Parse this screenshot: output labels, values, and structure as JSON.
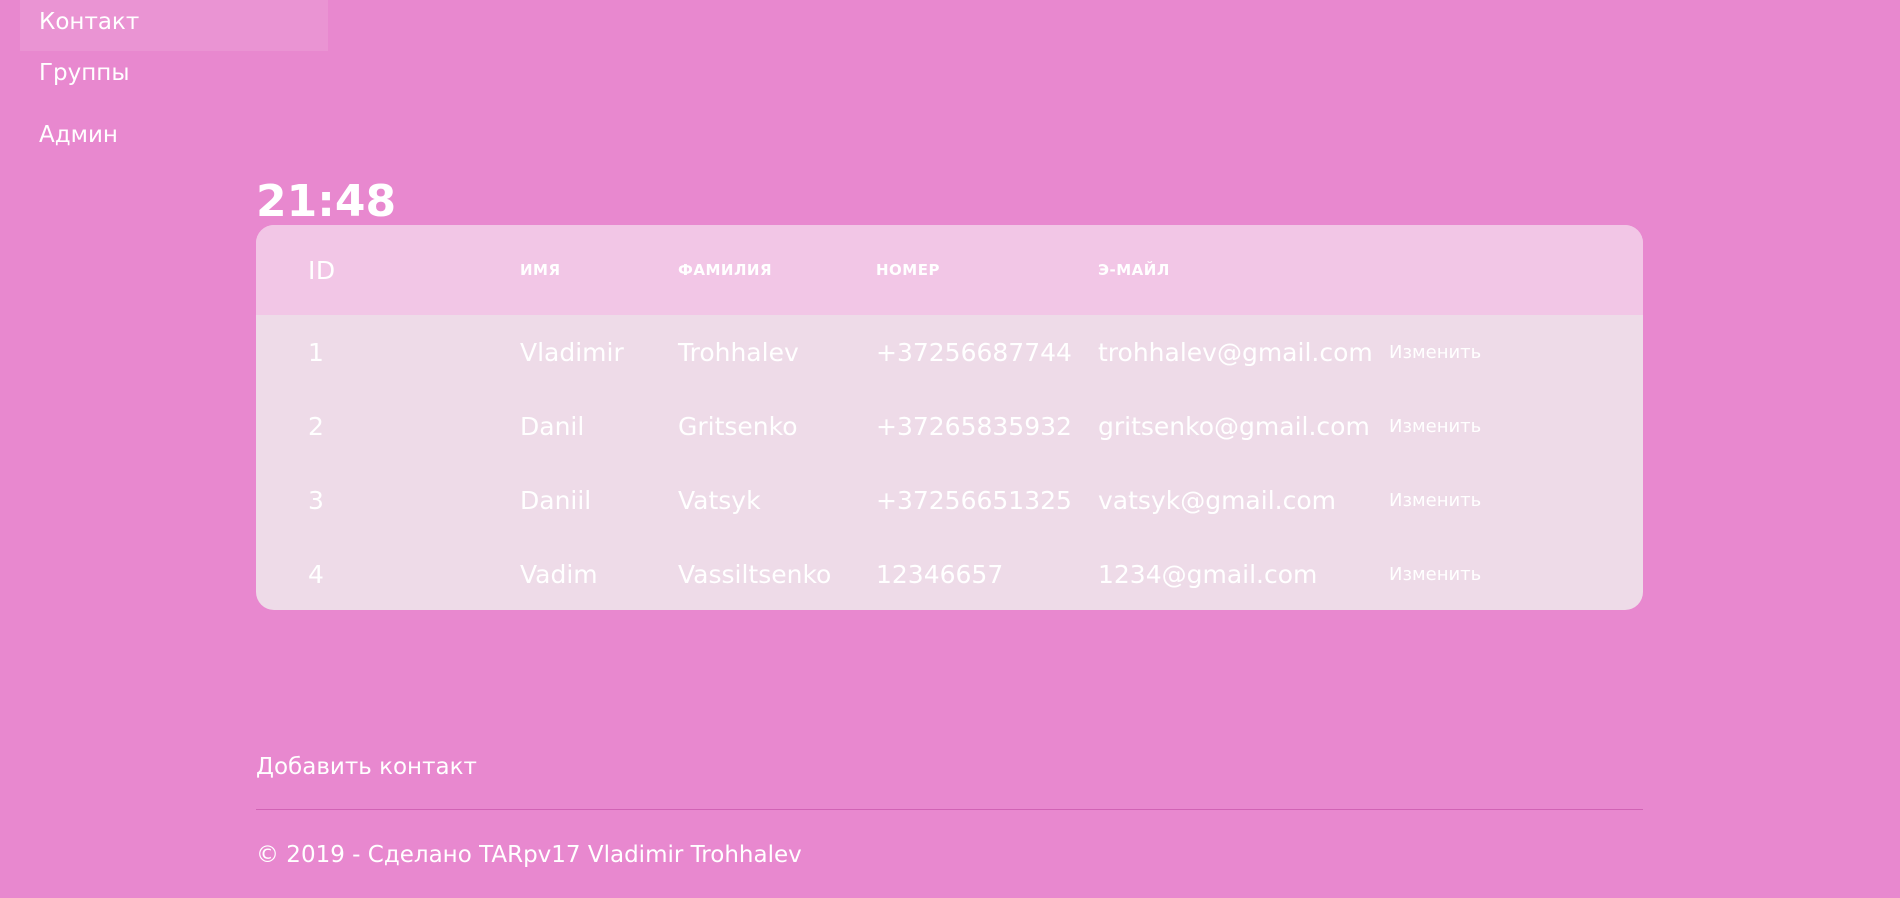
{
  "nav": {
    "items": [
      {
        "label": "Контакт",
        "active": true
      },
      {
        "label": "Группы",
        "active": false
      },
      {
        "label": "Админ",
        "active": false
      }
    ]
  },
  "clock": "21:48",
  "table": {
    "headers": {
      "id": "ID",
      "name": "ИМЯ",
      "surname": "ФАМИЛИЯ",
      "phone": "НОМЕР",
      "email": "Э-МАЙЛ"
    },
    "rows": [
      {
        "id": "1",
        "name": "Vladimir",
        "surname": "Trohhalev",
        "phone": "+37256687744",
        "email": "trohhalev@gmail.com",
        "edit": "Изменить"
      },
      {
        "id": "2",
        "name": "Danil",
        "surname": "Gritsenko",
        "phone": "+37265835932",
        "email": "gritsenko@gmail.com",
        "edit": "Изменить"
      },
      {
        "id": "3",
        "name": "Daniil",
        "surname": "Vatsyk",
        "phone": "+37256651325",
        "email": "vatsyk@gmail.com",
        "edit": "Изменить"
      },
      {
        "id": "4",
        "name": "Vadim",
        "surname": "Vassiltsenko",
        "phone": "12346657",
        "email": "1234@gmail.com",
        "edit": "Изменить"
      }
    ]
  },
  "add_contact_label": "Добавить контакт",
  "footer_text": "© 2019 - Сделано TARpv17 Vladimir Trohhalev",
  "colors": {
    "background": "#e888cf",
    "table_header": "#f2c6e6",
    "table_body": "#eedbe8"
  }
}
